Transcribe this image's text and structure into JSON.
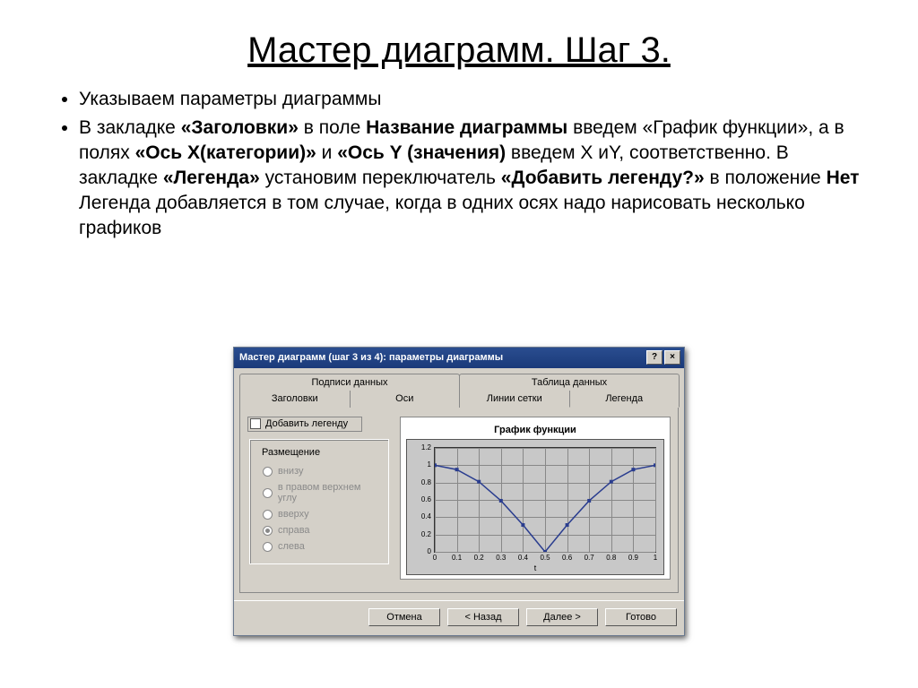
{
  "title": "Мастер диаграмм. Шаг 3.",
  "bullets": {
    "li1": "Указываем параметры диаграммы",
    "li2_a": "В закладке ",
    "li2_b1": "«Заголовки»",
    "li2_c": " в поле ",
    "li2_b2": "Название диаграммы",
    "li2_d": " введем «График функции», а в полях ",
    "li2_b3": "«Ось Х(категории)»",
    "li2_e": " и ",
    "li2_b4": "«Ось Y (значения)",
    "li2_f": " введем X иY, соответственно. В закладке ",
    "li2_b5": "«Легенда»",
    "li2_g": " установим переключатель ",
    "li2_b6": "«Добавить легенду?»",
    "li2_h": " в положение ",
    "li2_b7": "Нет",
    "li2_i": " Легенда добавляется в том случае, когда в одних осях надо нарисовать несколько графиков"
  },
  "dialog": {
    "title": "Мастер диаграмм (шаг 3 из 4): параметры диаграммы",
    "help_btn": "?",
    "close_btn": "×",
    "tabs_row1": {
      "t1": "Подписи данных",
      "t2": "Таблица данных"
    },
    "tabs_row2": {
      "t1": "Заголовки",
      "t2": "Оси",
      "t3": "Линии сетки",
      "t4": "Легенда"
    },
    "checkbox_label": "Добавить легенду",
    "group_title": "Размещение",
    "radios": {
      "r1": "внизу",
      "r2": "в правом верхнем углу",
      "r3": "вверху",
      "r4": "справа",
      "r5": "слева"
    },
    "preview_title": "График функции",
    "xlabel": "t",
    "buttons": {
      "cancel": "Отмена",
      "back": "< Назад",
      "next": "Далее >",
      "finish": "Готово"
    }
  },
  "chart_data": {
    "type": "line",
    "title": "График функции",
    "xlabel": "t",
    "ylabel": "",
    "ylim": [
      0,
      1.2
    ],
    "xlim": [
      0,
      1
    ],
    "x": [
      0,
      0.1,
      0.2,
      0.3,
      0.4,
      0.5,
      0.6,
      0.7,
      0.8,
      0.9,
      1.0
    ],
    "values": [
      1.0,
      0.95,
      0.81,
      0.59,
      0.31,
      0.0,
      0.31,
      0.59,
      0.81,
      0.95,
      1.0
    ],
    "xticks": [
      0,
      0.1,
      0.2,
      0.3,
      0.4,
      0.5,
      0.6,
      0.7,
      0.8,
      0.9,
      1
    ],
    "yticks": [
      0,
      0.2,
      0.4,
      0.6,
      0.8,
      1,
      1.2
    ]
  }
}
